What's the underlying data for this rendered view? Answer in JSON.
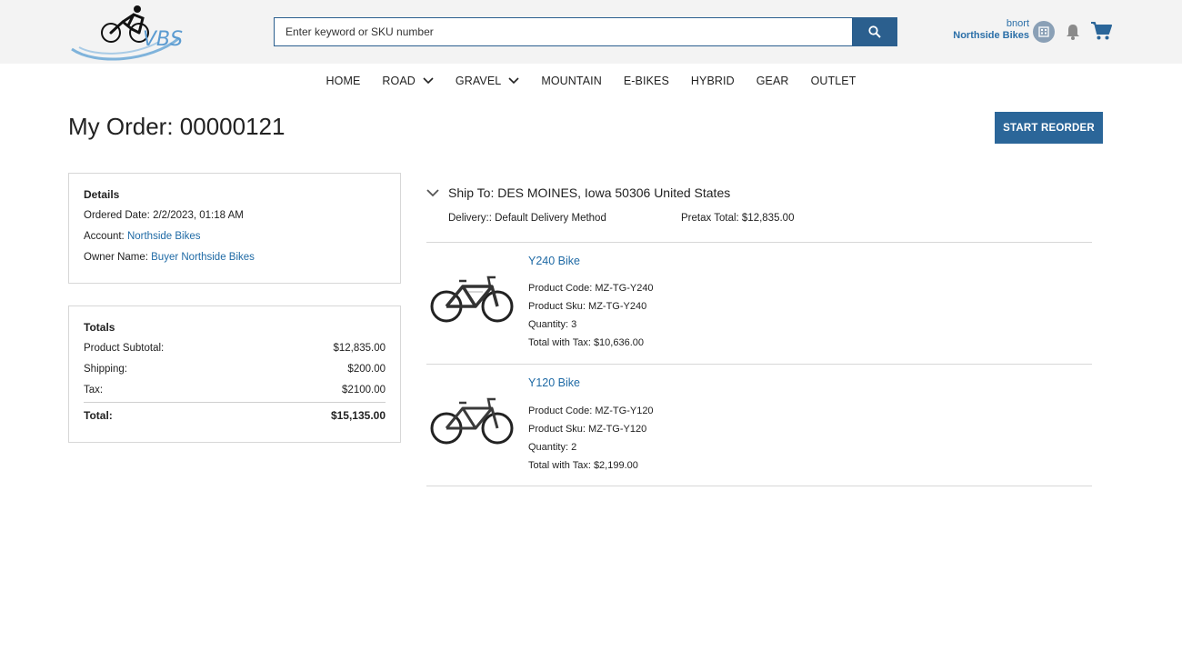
{
  "header": {
    "logo_text": "VBS",
    "search_placeholder": "Enter keyword or SKU number",
    "user_name": "bnort",
    "company": "Northside Bikes"
  },
  "nav": [
    {
      "label": "HOME",
      "has_dropdown": false
    },
    {
      "label": "ROAD",
      "has_dropdown": true
    },
    {
      "label": "GRAVEL",
      "has_dropdown": true
    },
    {
      "label": "MOUNTAIN",
      "has_dropdown": false
    },
    {
      "label": "E-BIKES",
      "has_dropdown": false
    },
    {
      "label": "HYBRID",
      "has_dropdown": false
    },
    {
      "label": "GEAR",
      "has_dropdown": false
    },
    {
      "label": "OUTLET",
      "has_dropdown": false
    }
  ],
  "page": {
    "title": "My Order: 00000121",
    "reorder_label": "START REORDER"
  },
  "details": {
    "heading": "Details",
    "ordered_label": "Ordered Date:",
    "ordered_value": "2/2/2023, 01:18 AM",
    "account_label": "Account:",
    "account_value": "Northside Bikes",
    "owner_label": "Owner Name:",
    "owner_value": "Buyer Northside Bikes"
  },
  "totals": {
    "heading": "Totals",
    "rows": [
      {
        "label": "Product Subtotal:",
        "value": "$12,835.00"
      },
      {
        "label": "Shipping:",
        "value": "$200.00"
      },
      {
        "label": "Tax:",
        "value": "$2100.00"
      }
    ],
    "total_label": "Total:",
    "total_value": "$15,135.00"
  },
  "shipment": {
    "ship_to": "Ship To: DES MOINES, Iowa 50306 United States",
    "delivery": "Delivery:: Default Delivery Method",
    "pretax": "Pretax Total: $12,835.00"
  },
  "items": [
    {
      "name": "Y240 Bike",
      "code": "Product Code: MZ-TG-Y240",
      "sku": "Product Sku: MZ-TG-Y240",
      "qty": "Quantity: 3",
      "total": "Total with Tax: $10,636.00"
    },
    {
      "name": "Y120 Bike",
      "code": "Product Code: MZ-TG-Y120",
      "sku": "Product Sku: MZ-TG-Y120",
      "qty": "Quantity: 2",
      "total": "Total with Tax: $2,199.00"
    }
  ],
  "colors": {
    "accent": "#2b6699",
    "link": "#1f6aa5",
    "topbar": "#f3f3f3"
  }
}
